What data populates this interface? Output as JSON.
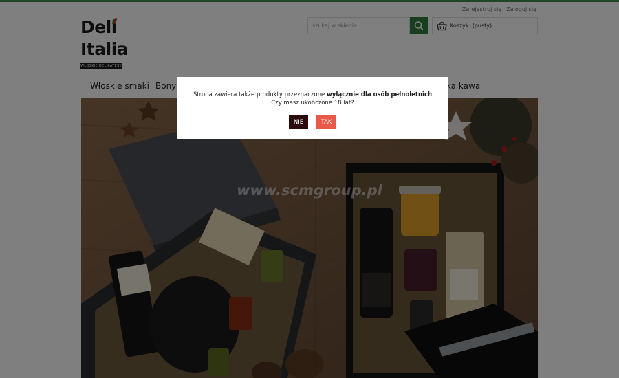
{
  "header": {
    "links": [
      "Zarejestruj się",
      "Zaloguj się"
    ],
    "logo": {
      "line1": "Deli",
      "line2": "Italia",
      "tagline": "WŁOSKIE DELIKATESY"
    },
    "search": {
      "placeholder": "szukaj w sklepie...",
      "icon": "search-icon"
    },
    "cart": {
      "label": "Koszyk: (pusty)",
      "icon": "basket-icon"
    }
  },
  "nav": {
    "items": [
      "Włoskie smaki",
      "Bony u",
      "ka kawa"
    ]
  },
  "hero": {
    "watermark": "www.scmgroup.pl"
  },
  "modal": {
    "text_before": "Strona zawiera także produkty przeznaczone ",
    "text_bold": "wyłącznie dla osób pełnoletnich",
    "question": "Czy masz ukończone 18 lat?",
    "no_label": "NIE",
    "yes_label": "TAK"
  },
  "colors": {
    "brand_green": "#2e7d3e",
    "yes_red": "#e8594a",
    "no_dark": "#2a0a0a"
  }
}
